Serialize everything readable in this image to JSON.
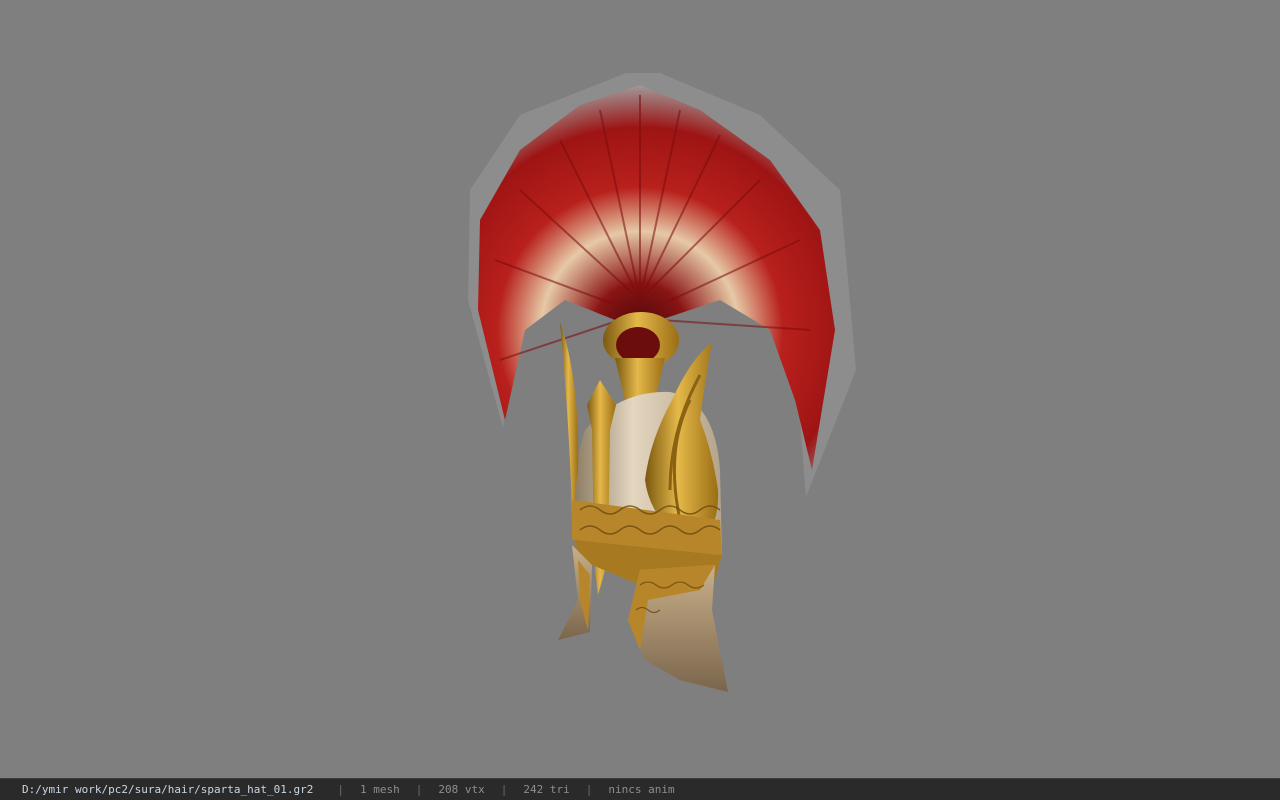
{
  "viewer": {
    "background_color": "#7f7f7f",
    "model_icon": "spartan-helmet-model"
  },
  "statusbar": {
    "file_path": "D:/ymir work/pc2/sura/hair/sparta_hat_01.gr2",
    "separator": "|",
    "mesh_count": "1 mesh",
    "vertex_count": "208 vtx",
    "triangle_count": "242 tri",
    "animation": "nincs anim"
  }
}
